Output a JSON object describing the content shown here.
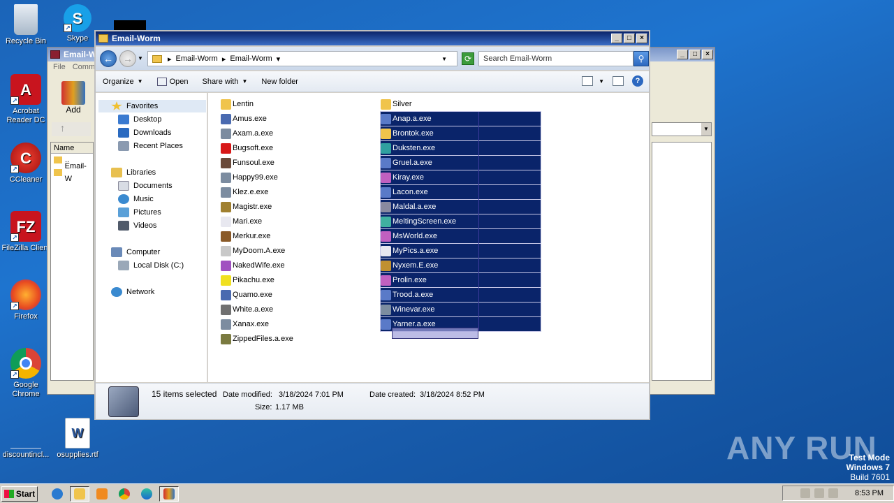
{
  "desktop": {
    "icons": [
      {
        "label": "Recycle Bin",
        "icon": "recycle-bin-icon"
      },
      {
        "label": "Skype",
        "icon": "skype-icon"
      },
      {
        "label": "Acrobat Reader DC",
        "icon": "acrobat-icon"
      },
      {
        "label": "CCleaner",
        "icon": "ccleaner-icon"
      },
      {
        "label": "FileZilla Client",
        "icon": "filezilla-icon"
      },
      {
        "label": "Firefox",
        "icon": "firefox-icon"
      },
      {
        "label": "Google Chrome",
        "icon": "chrome-icon"
      },
      {
        "label": "discountincl...",
        "icon": "blank-file-icon"
      },
      {
        "label": "osupplies.rtf",
        "icon": "word-doc-icon"
      },
      {
        "label": "Add",
        "icon": "winrar-icon"
      }
    ],
    "watermark": {
      "line1": "Test Mode",
      "line2": "Windows 7",
      "line3": "Build 7601"
    },
    "brand": "ANY RUN"
  },
  "back_window": {
    "title": "Email-W",
    "menu": [
      "File",
      "Comm"
    ],
    "column_header": "Name",
    "rows": [
      "..",
      "Email-W"
    ]
  },
  "explorer": {
    "title": "Email-Worm",
    "breadcrumb": [
      "Email-Worm",
      "Email-Worm"
    ],
    "search_placeholder": "Search Email-Worm",
    "toolbar": {
      "organize": "Organize",
      "open": "Open",
      "share_with": "Share with",
      "new_folder": "New folder"
    },
    "nav": {
      "favorites": "Favorites",
      "desktop": "Desktop",
      "downloads": "Downloads",
      "recent_places": "Recent Places",
      "libraries": "Libraries",
      "documents": "Documents",
      "music": "Music",
      "pictures": "Pictures",
      "videos": "Videos",
      "computer": "Computer",
      "local_disk": "Local Disk (C:)",
      "network": "Network"
    },
    "files_col1": [
      {
        "name": "Lentin",
        "color": "#f0c44c"
      },
      {
        "name": "Amus.exe",
        "color": "#4a6ab0"
      },
      {
        "name": "Axam.a.exe",
        "color": "#7c8ca0"
      },
      {
        "name": "Bugsoft.exe",
        "color": "#d81818"
      },
      {
        "name": "Funsoul.exe",
        "color": "#6a4a3a"
      },
      {
        "name": "Happy99.exe",
        "color": "#7c8ca0"
      },
      {
        "name": "Klez.e.exe",
        "color": "#7c8ca0"
      },
      {
        "name": "Magistr.exe",
        "color": "#a08030"
      },
      {
        "name": "Mari.exe",
        "color": "#e8e8f0"
      },
      {
        "name": "Merkur.exe",
        "color": "#8a5a28"
      },
      {
        "name": "MyDoom.A.exe",
        "color": "#c8c8c8"
      },
      {
        "name": "NakedWife.exe",
        "color": "#a050c0"
      },
      {
        "name": "Pikachu.exe",
        "color": "#f0e020"
      },
      {
        "name": "Quamo.exe",
        "color": "#4a6ab0"
      },
      {
        "name": "White.a.exe",
        "color": "#707070"
      },
      {
        "name": "Xanax.exe",
        "color": "#7c8ca0"
      },
      {
        "name": "ZippedFiles.a.exe",
        "color": "#7a7a40"
      }
    ],
    "files_col2": [
      {
        "name": "Silver",
        "color": "#f0c44c",
        "selected": false
      },
      {
        "name": "Anap.a.exe",
        "color": "#5a7ac8",
        "selected": true
      },
      {
        "name": "Brontok.exe",
        "color": "#f0c44c",
        "selected": true
      },
      {
        "name": "Duksten.exe",
        "color": "#30a0a0",
        "selected": true
      },
      {
        "name": "Gruel.a.exe",
        "color": "#5a7ac8",
        "selected": true
      },
      {
        "name": "Kiray.exe",
        "color": "#c060c0",
        "selected": true
      },
      {
        "name": "Lacon.exe",
        "color": "#5a7ac8",
        "selected": true
      },
      {
        "name": "Maldal.a.exe",
        "color": "#8a8aa0",
        "selected": true
      },
      {
        "name": "MeltingScreen.exe",
        "color": "#40b0a0",
        "selected": true
      },
      {
        "name": "MsWorld.exe",
        "color": "#c060c0",
        "selected": true
      },
      {
        "name": "MyPics.a.exe",
        "color": "#e8e8f0",
        "selected": true
      },
      {
        "name": "Nyxem.E.exe",
        "color": "#c09030",
        "selected": true
      },
      {
        "name": "Prolin.exe",
        "color": "#c060c0",
        "selected": true
      },
      {
        "name": "Trood.a.exe",
        "color": "#5a7ac8",
        "selected": true
      },
      {
        "name": "Winevar.exe",
        "color": "#7c8ca0",
        "selected": true
      },
      {
        "name": "Yarner.a.exe",
        "color": "#5a7ac8",
        "selected": true
      }
    ],
    "details": {
      "count": "15 items selected",
      "date_modified_label": "Date modified:",
      "date_modified": "3/18/2024 7:01 PM",
      "date_created_label": "Date created:",
      "date_created": "3/18/2024 8:52 PM",
      "size_label": "Size:",
      "size": "1.17 MB"
    }
  },
  "taskbar": {
    "start": "Start",
    "clock": "8:53 PM"
  }
}
